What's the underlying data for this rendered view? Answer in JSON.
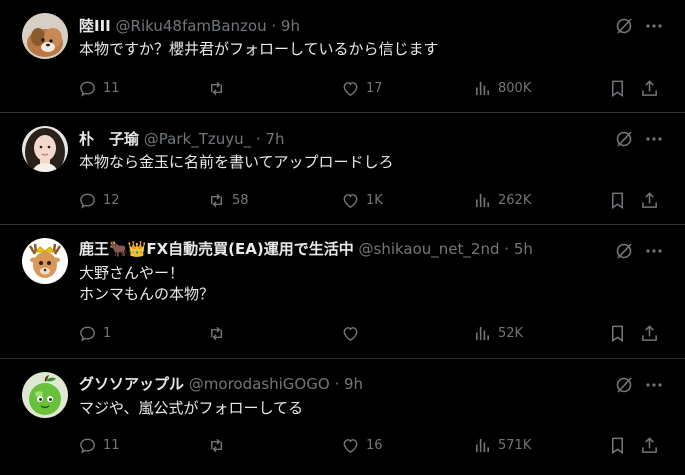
{
  "tweets": [
    {
      "name": "陸III",
      "handle": "@Riku48famBanzou",
      "dot": "·",
      "time": "9h",
      "text": "本物ですか？櫻井君がフォローしているから信じます",
      "replies": "11",
      "retweets": "",
      "likes": "17",
      "views": "800K"
    },
    {
      "name": "朴　子瑜",
      "handle": "@Park_Tzuyu_",
      "dot": "·",
      "time": "7h",
      "text": "本物なら金玉に名前を書いてアップロードしろ",
      "replies": "12",
      "retweets": "58",
      "likes": "1K",
      "views": "262K"
    },
    {
      "name": "鹿王🐂👑FX自動売買(EA)運用で生活中",
      "handle": "@shikaou_net_2nd",
      "dot": "·",
      "time": "5h",
      "text": "大野さんやー！\nホンマもんの本物？",
      "replies": "1",
      "retweets": "",
      "likes": "",
      "views": "52K"
    },
    {
      "name": "グソソアップル",
      "handle": "@morodashiGOGO",
      "dot": "·",
      "time": "9h",
      "text": "マジや、嵐公式がフォローしてる",
      "replies": "11",
      "retweets": "",
      "likes": "16",
      "views": "571K"
    }
  ],
  "icons": {
    "grok": "grok-icon",
    "more": "more-icon",
    "reply": "reply-icon",
    "retweet": "retweet-icon",
    "like": "like-icon",
    "views": "views-icon",
    "bookmark": "bookmark-icon",
    "share": "share-icon"
  },
  "colors": {
    "background": "#000000",
    "text": "#e7e9ea",
    "muted": "#71767b",
    "divider": "#2f3336"
  }
}
